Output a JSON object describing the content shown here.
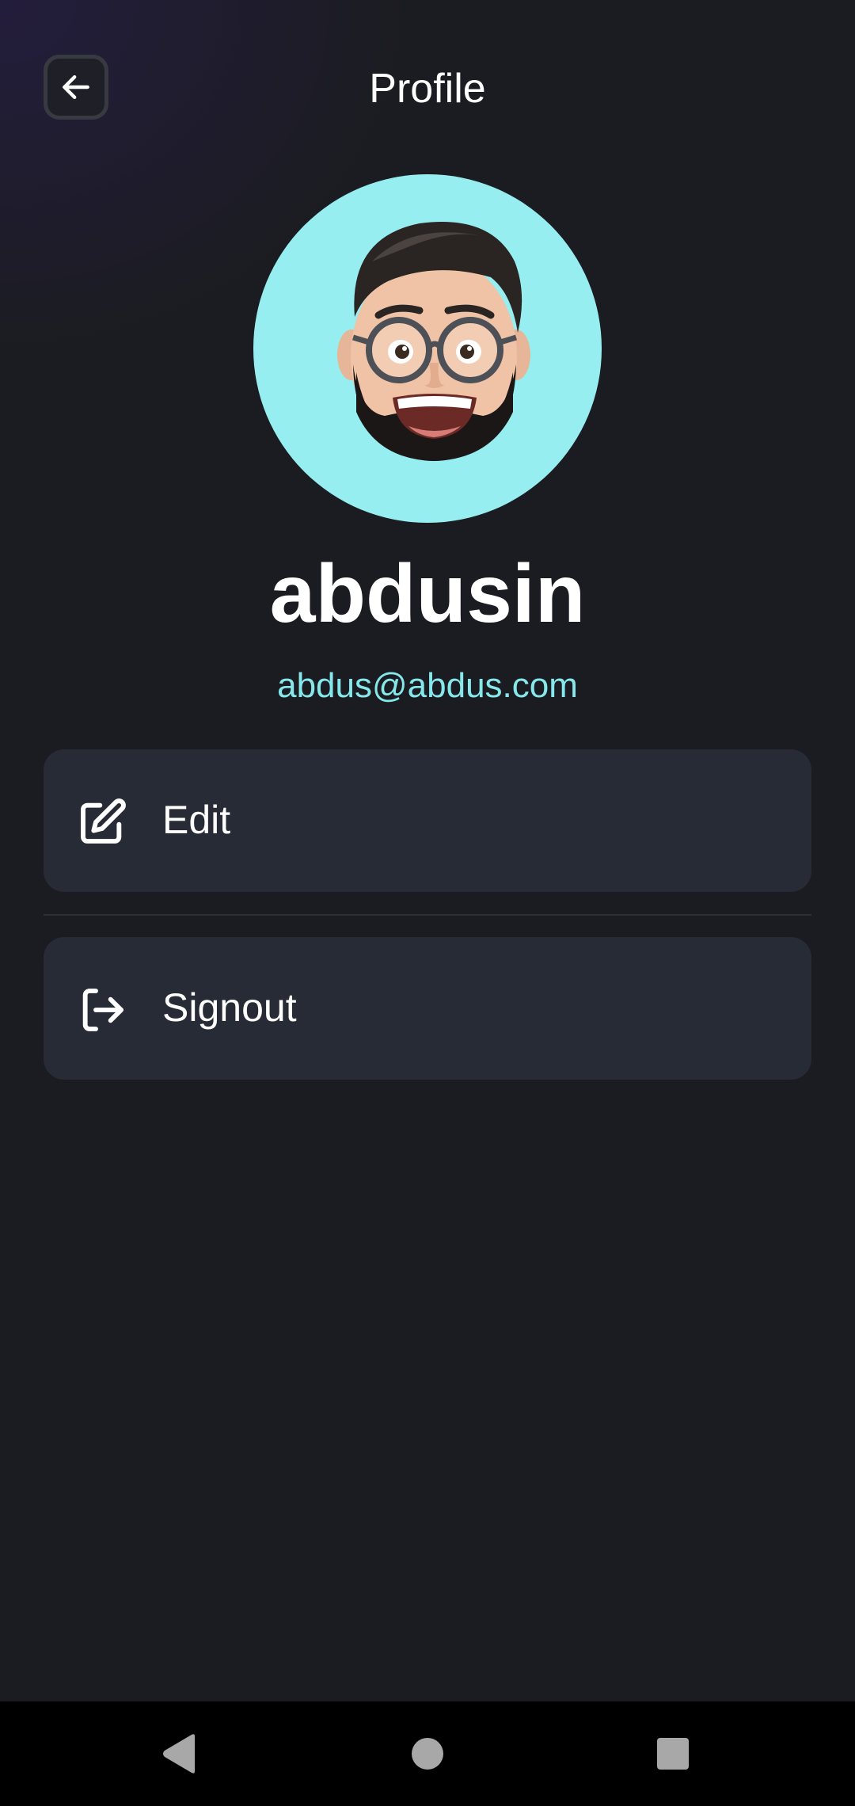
{
  "header": {
    "title": "Profile",
    "back_icon": "arrow-left-icon"
  },
  "profile": {
    "avatar_icon": "memoji-avatar",
    "avatar_bg": "#97eef0",
    "name": "abdusin",
    "email": "abdus@abdus.com",
    "email_color": "#86e8ea"
  },
  "menu": {
    "items": [
      {
        "label": "Edit",
        "icon": "edit-icon"
      },
      {
        "label": "Signout",
        "icon": "signout-icon"
      }
    ]
  },
  "system_nav": {
    "back": "nav-back-icon",
    "home": "nav-home-icon",
    "recents": "nav-recents-icon"
  },
  "colors": {
    "background": "#1b1c21",
    "card": "#272b36",
    "text": "#ffffff"
  }
}
